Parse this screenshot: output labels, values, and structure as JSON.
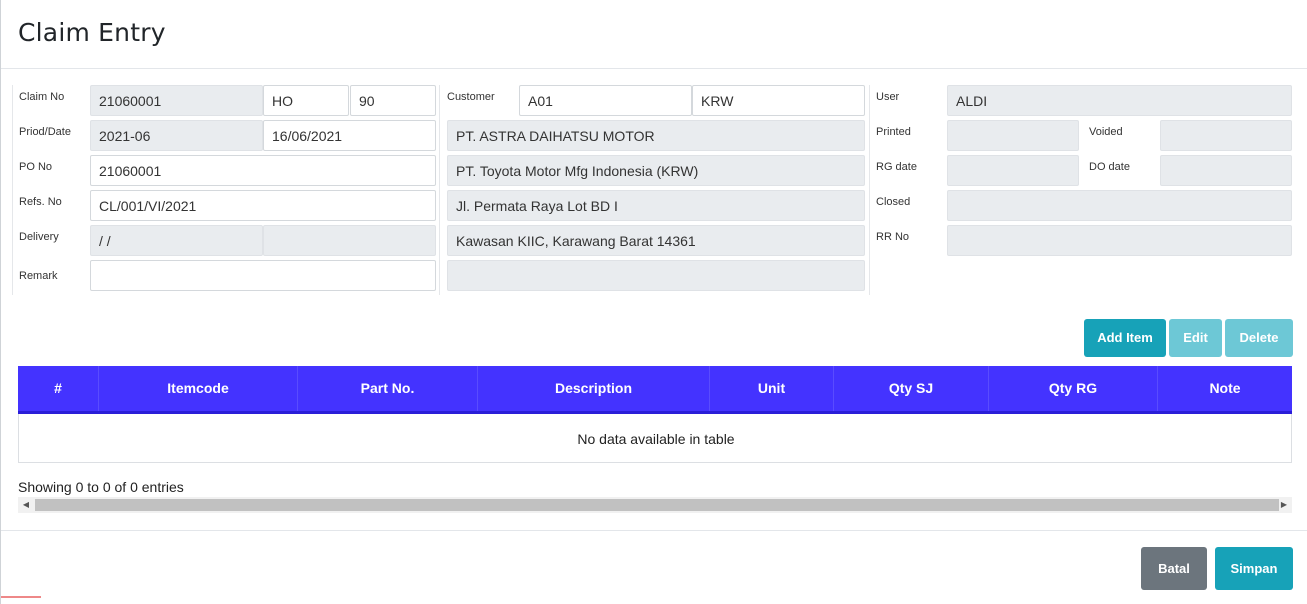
{
  "header": {
    "title": "Claim Entry"
  },
  "left": {
    "claim_no_label": "Claim No",
    "claim_no": "21060001",
    "claim_branch": "HO",
    "claim_seq": "90",
    "period_label": "Priod/Date",
    "period": "2021-06",
    "date": "16/06/2021",
    "po_label": "PO No",
    "po": "21060001",
    "refs_label": "Refs. No",
    "refs": "CL/001/VI/2021",
    "delivery_label": "Delivery",
    "delivery": "/ /",
    "delivery2": "",
    "remark_label": "Remark",
    "remark": ""
  },
  "middle": {
    "customer_label": "Customer",
    "customer_code": "A01",
    "customer_area": "KRW",
    "line1": "PT. ASTRA DAIHATSU MOTOR",
    "line2": "PT. Toyota Motor Mfg Indonesia  (KRW)",
    "line3": "Jl. Permata Raya Lot BD I",
    "line4": "Kawasan KIIC, Karawang Barat 14361",
    "line5": ""
  },
  "right": {
    "user_label": "User",
    "user": "ALDI",
    "printed_label": "Printed",
    "printed": "",
    "voided_label": "Voided",
    "voided": "",
    "rg_label": "RG date",
    "rg": "",
    "do_label": "DO date",
    "do": "",
    "closed_label": "Closed",
    "closed": "",
    "rr_label": "RR No",
    "rr": ""
  },
  "actions": {
    "add": "Add Item",
    "edit": "Edit",
    "delete": "Delete"
  },
  "table": {
    "columns": [
      "#",
      "Itemcode",
      "Part No.",
      "Description",
      "Unit",
      "Qty SJ",
      "Qty RG",
      "Note"
    ],
    "empty": "No data available in table",
    "info": "Showing 0 to 0 of 0 entries"
  },
  "footer": {
    "cancel": "Batal",
    "save": "Simpan"
  },
  "colors": {
    "header_bg": "#4433ff",
    "primary": "#17a2b8",
    "secondary": "#6c757d"
  }
}
